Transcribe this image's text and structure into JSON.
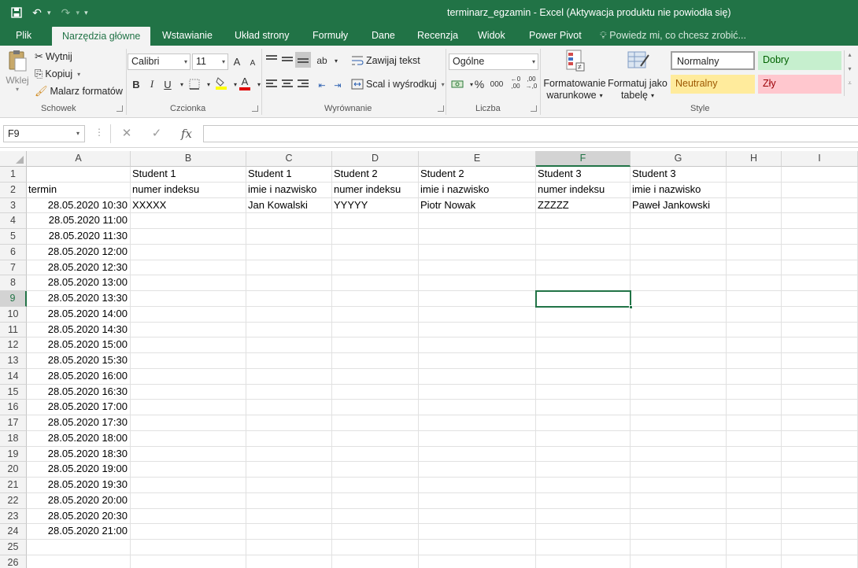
{
  "window": {
    "title": "terminarz_egzamin - Excel (Aktywacja produktu nie powiodła się)"
  },
  "tabs": [
    "Plik",
    "Narzędzia główne",
    "Wstawianie",
    "Układ strony",
    "Formuły",
    "Dane",
    "Recenzja",
    "Widok",
    "Power Pivot"
  ],
  "active_tab": "Narzędzia główne",
  "tell_me": "Powiedz mi, co chcesz zrobić...",
  "ribbon": {
    "clipboard": {
      "paste": "Wklej",
      "cut": "Wytnij",
      "copy": "Kopiuj",
      "format_painter": "Malarz formatów",
      "label": "Schowek"
    },
    "font": {
      "name": "Calibri",
      "size": "11",
      "grow": "A",
      "shrink": "A",
      "bold": "B",
      "italic": "I",
      "underline": "U",
      "font_color_glyph": "A",
      "label": "Czcionka"
    },
    "alignment": {
      "wrap": "Zawijaj tekst",
      "merge": "Scal i wyśrodkuj",
      "label": "Wyrównanie"
    },
    "number": {
      "format": "Ogólne",
      "percent": "%",
      "thousands": "000",
      "label": "Liczba"
    },
    "styles": {
      "conditional": [
        "Formatowanie",
        "warunkowe"
      ],
      "as_table": [
        "Formatuj jako",
        "tabelę"
      ],
      "normal": "Normalny",
      "good": "Dobry",
      "neutral": "Neutralny",
      "bad": "Zły",
      "label": "Style",
      "colors": {
        "good_bg": "#c6efce",
        "good_fg": "#006100",
        "neutral_bg": "#ffeb9c",
        "neutral_fg": "#9c5700",
        "bad_bg": "#ffc7ce",
        "bad_fg": "#9c0006"
      }
    }
  },
  "formula_bar": {
    "name_box": "F9",
    "fx": "fx",
    "formula": ""
  },
  "sheet": {
    "columns": [
      "A",
      "B",
      "C",
      "D",
      "E",
      "F",
      "G",
      "H",
      "I"
    ],
    "selected_column": "F",
    "selected_row": 9,
    "rows": [
      {
        "n": "1",
        "cells": [
          "",
          "Student 1",
          "Student 1",
          "Student 2",
          "Student 2",
          "Student 3",
          "Student 3",
          "",
          ""
        ]
      },
      {
        "n": "2",
        "cells": [
          "termin",
          "numer indeksu",
          "imie i nazwisko",
          "numer indeksu",
          "imie i nazwisko",
          "numer indeksu",
          "imie i nazwisko",
          "",
          ""
        ]
      },
      {
        "n": "3",
        "cells": [
          "28.05.2020 10:30",
          "XXXXX",
          "Jan Kowalski",
          "YYYYY",
          "Piotr Nowak",
          "ZZZZZ",
          "Paweł Jankowski",
          "",
          ""
        ]
      },
      {
        "n": "4",
        "cells": [
          "28.05.2020 11:00",
          "",
          "",
          "",
          "",
          "",
          "",
          "",
          ""
        ]
      },
      {
        "n": "5",
        "cells": [
          "28.05.2020 11:30",
          "",
          "",
          "",
          "",
          "",
          "",
          "",
          ""
        ]
      },
      {
        "n": "6",
        "cells": [
          "28.05.2020 12:00",
          "",
          "",
          "",
          "",
          "",
          "",
          "",
          ""
        ]
      },
      {
        "n": "7",
        "cells": [
          "28.05.2020 12:30",
          "",
          "",
          "",
          "",
          "",
          "",
          "",
          ""
        ]
      },
      {
        "n": "8",
        "cells": [
          "28.05.2020 13:00",
          "",
          "",
          "",
          "",
          "",
          "",
          "",
          ""
        ]
      },
      {
        "n": "9",
        "cells": [
          "28.05.2020 13:30",
          "",
          "",
          "",
          "",
          "",
          "",
          "",
          ""
        ]
      },
      {
        "n": "10",
        "cells": [
          "28.05.2020 14:00",
          "",
          "",
          "",
          "",
          "",
          "",
          "",
          ""
        ]
      },
      {
        "n": "11",
        "cells": [
          "28.05.2020 14:30",
          "",
          "",
          "",
          "",
          "",
          "",
          "",
          ""
        ]
      },
      {
        "n": "12",
        "cells": [
          "28.05.2020 15:00",
          "",
          "",
          "",
          "",
          "",
          "",
          "",
          ""
        ]
      },
      {
        "n": "13",
        "cells": [
          "28.05.2020 15:30",
          "",
          "",
          "",
          "",
          "",
          "",
          "",
          ""
        ]
      },
      {
        "n": "14",
        "cells": [
          "28.05.2020 16:00",
          "",
          "",
          "",
          "",
          "",
          "",
          "",
          ""
        ]
      },
      {
        "n": "15",
        "cells": [
          "28.05.2020 16:30",
          "",
          "",
          "",
          "",
          "",
          "",
          "",
          ""
        ]
      },
      {
        "n": "16",
        "cells": [
          "28.05.2020 17:00",
          "",
          "",
          "",
          "",
          "",
          "",
          "",
          ""
        ]
      },
      {
        "n": "17",
        "cells": [
          "28.05.2020 17:30",
          "",
          "",
          "",
          "",
          "",
          "",
          "",
          ""
        ]
      },
      {
        "n": "18",
        "cells": [
          "28.05.2020 18:00",
          "",
          "",
          "",
          "",
          "",
          "",
          "",
          ""
        ]
      },
      {
        "n": "19",
        "cells": [
          "28.05.2020 18:30",
          "",
          "",
          "",
          "",
          "",
          "",
          "",
          ""
        ]
      },
      {
        "n": "20",
        "cells": [
          "28.05.2020 19:00",
          "",
          "",
          "",
          "",
          "",
          "",
          "",
          ""
        ]
      },
      {
        "n": "21",
        "cells": [
          "28.05.2020 19:30",
          "",
          "",
          "",
          "",
          "",
          "",
          "",
          ""
        ]
      },
      {
        "n": "22",
        "cells": [
          "28.05.2020 20:00",
          "",
          "",
          "",
          "",
          "",
          "",
          "",
          ""
        ]
      },
      {
        "n": "23",
        "cells": [
          "28.05.2020 20:30",
          "",
          "",
          "",
          "",
          "",
          "",
          "",
          ""
        ]
      },
      {
        "n": "24",
        "cells": [
          "28.05.2020 21:00",
          "",
          "",
          "",
          "",
          "",
          "",
          "",
          ""
        ]
      },
      {
        "n": "25",
        "cells": [
          "",
          "",
          "",
          "",
          "",
          "",
          "",
          "",
          ""
        ]
      },
      {
        "n": "26",
        "cells": [
          "",
          "",
          "",
          "",
          "",
          "",
          "",
          "",
          ""
        ]
      }
    ]
  },
  "colors": {
    "brand": "#217346",
    "grid_line": "#e1e1e1",
    "header_bg": "#f3f3f3"
  }
}
